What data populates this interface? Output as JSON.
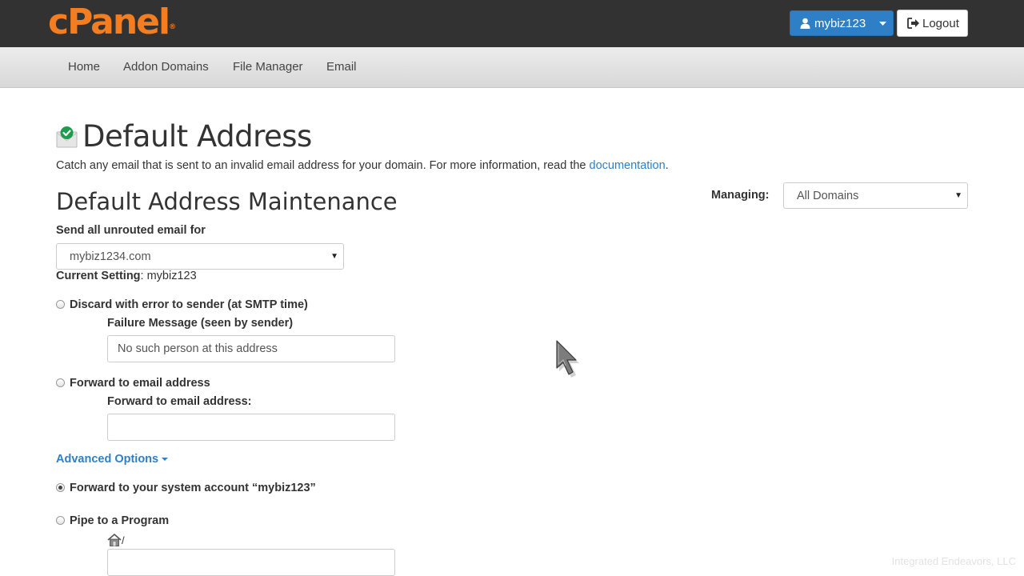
{
  "header": {
    "logo_text": "cPanel",
    "logo_mark": "®",
    "user_label": "mybiz123",
    "logout_label": "Logout",
    "colors": {
      "topbar": "#323232",
      "logo": "#f47d20",
      "primary": "#2f7fc6"
    }
  },
  "nav": {
    "items": [
      {
        "label": "Home"
      },
      {
        "label": "Addon Domains"
      },
      {
        "label": "File Manager"
      },
      {
        "label": "Email"
      }
    ]
  },
  "page": {
    "title": "Default Address",
    "intro_text": "Catch any email that is sent to an invalid email address for your domain. For more information, read the ",
    "intro_link": "documentation",
    "intro_end": ".",
    "section_title": "Default Address Maintenance"
  },
  "managing": {
    "label": "Managing:",
    "selected": "All Domains"
  },
  "form": {
    "send_label": "Send all unrouted email for",
    "domain_selected": "mybiz1234.com",
    "current_setting_label": "Current Setting",
    "current_setting_value": ": mybiz123",
    "discard_label": "Discard with error to sender (at SMTP time)",
    "failure_label": "Failure Message (seen by sender)",
    "failure_value": "No such person at this address",
    "forward_label": "Forward to email address",
    "forward_field_label": "Forward to email address:",
    "forward_value": "",
    "advanced_label": "Advanced Options",
    "system_account_label": "Forward to your system account “mybiz123”",
    "pipe_label": "Pipe to a Program",
    "pipe_prefix": "/",
    "pipe_value": "",
    "selected_option": "system_account"
  },
  "watermark": "Integrated Endeavors, LLC"
}
